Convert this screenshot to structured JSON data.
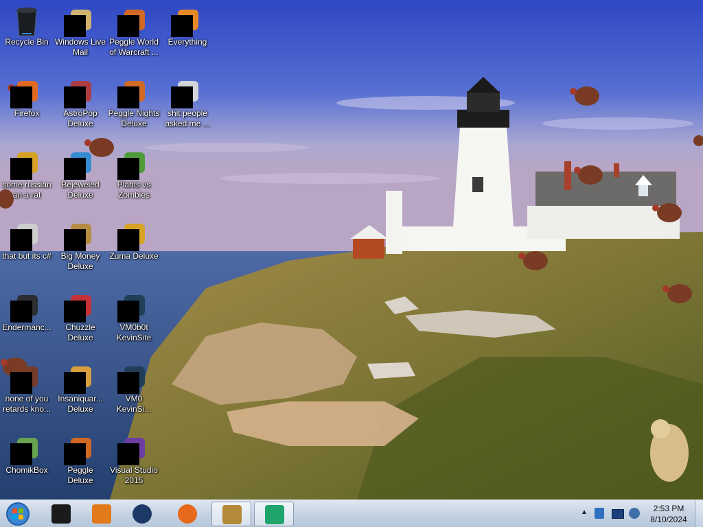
{
  "desktop": {
    "icons": [
      {
        "label": "Recycle Bin",
        "icon": "recycle-bin-icon"
      },
      {
        "label": "Windows Live Mail",
        "icon": "mail-icon"
      },
      {
        "label": "Peggle World of Warcraft ...",
        "icon": "peggle-icon"
      },
      {
        "label": "Everything",
        "icon": "search-icon"
      },
      {
        "label": "Firefox",
        "icon": "firefox-icon"
      },
      {
        "label": "AstroPop Deluxe",
        "icon": "game-icon"
      },
      {
        "label": "Peggle Nights Deluxe",
        "icon": "peggle-icon"
      },
      {
        "label": "shit people asked me ...",
        "icon": "text-file-icon"
      },
      {
        "label": "some russian an a rat",
        "icon": "video-file-icon"
      },
      {
        "label": "Bejeweled Deluxe",
        "icon": "gem-icon"
      },
      {
        "label": "Plants vs Zombies",
        "icon": "plant-icon"
      },
      {
        "label": "that but its c#",
        "icon": "folder-icon"
      },
      {
        "label": "Big Money Deluxe",
        "icon": "money-bag-icon"
      },
      {
        "label": "Zuma Deluxe",
        "icon": "zuma-icon"
      },
      {
        "label": "Endermanc...",
        "icon": "app-icon"
      },
      {
        "label": "Chuzzle Deluxe",
        "icon": "chuzzle-icon"
      },
      {
        "label": "VM0b0t KevinSite",
        "icon": "terminal-icon"
      },
      {
        "label": "none of you retards kno...",
        "icon": "turkey-icon"
      },
      {
        "label": "Insaniquar... Deluxe",
        "icon": "fish-icon"
      },
      {
        "label": "VM0 KevinSi...",
        "icon": "terminal-icon"
      },
      {
        "label": "ChomikBox",
        "icon": "chomikbox-icon"
      },
      {
        "label": "Peggle Deluxe",
        "icon": "peggle-icon"
      },
      {
        "label": "Visual Studio 2015",
        "icon": "visual-studio-icon"
      }
    ]
  },
  "taskbar": {
    "start_label": "Start",
    "pinned": [
      {
        "name": "terminal",
        "icon": "terminal-icon"
      },
      {
        "name": "media-player",
        "icon": "media-player-icon"
      },
      {
        "name": "globe",
        "icon": "globe-icon"
      },
      {
        "name": "firefox",
        "icon": "firefox-icon"
      },
      {
        "name": "big-money",
        "icon": "money-bag-icon"
      },
      {
        "name": "package",
        "icon": "package-icon"
      }
    ],
    "clock_time": "2:53 PM",
    "clock_date": "8/10/2024"
  },
  "colors": {
    "sky_top": "#2f49c4",
    "sea": "#2b4b84",
    "taskbar": "#c7d4e4",
    "grass": "#8a7a3a"
  }
}
